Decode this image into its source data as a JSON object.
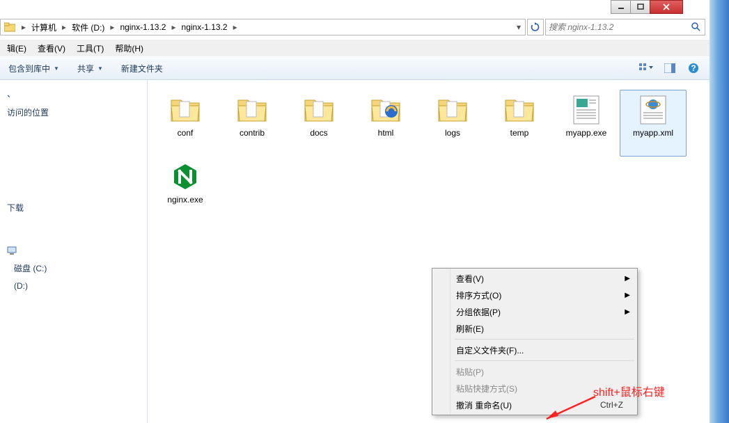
{
  "breadcrumb": {
    "items": [
      "计算机",
      "软件 (D:)",
      "nginx-1.13.2",
      "nginx-1.13.2"
    ]
  },
  "search": {
    "placeholder": "搜索 nginx-1.13.2"
  },
  "menu": {
    "edit": "辑(E)",
    "view": "查看(V)",
    "tools": "工具(T)",
    "help": "帮助(H)"
  },
  "toolbar": {
    "include": "包含到库中",
    "share": "共享",
    "new_folder": "新建文件夹"
  },
  "nav": {
    "recent_header_partial": "访问的位置",
    "downloads": "下载",
    "local_c": "磁盘 (C:)",
    "drive_d": "(D:)"
  },
  "files": [
    {
      "name": "conf",
      "type": "folder"
    },
    {
      "name": "contrib",
      "type": "folder"
    },
    {
      "name": "docs",
      "type": "folder"
    },
    {
      "name": "html",
      "type": "folder-ie"
    },
    {
      "name": "logs",
      "type": "folder"
    },
    {
      "name": "temp",
      "type": "folder"
    },
    {
      "name": "myapp.exe",
      "type": "config"
    },
    {
      "name": "myapp.xml",
      "type": "xml",
      "selected": true
    },
    {
      "name": "nginx.exe",
      "type": "nginx"
    }
  ],
  "context_menu": {
    "view": "查看(V)",
    "sort": "排序方式(O)",
    "group": "分组依据(P)",
    "refresh": "刷新(E)",
    "customize": "自定义文件夹(F)...",
    "paste": "粘贴(P)",
    "paste_shortcut": "粘贴快捷方式(S)",
    "undo_rename": "撤消 重命名(U)",
    "undo_shortcut": "Ctrl+Z"
  },
  "annotation": "shift+鼠标右键"
}
